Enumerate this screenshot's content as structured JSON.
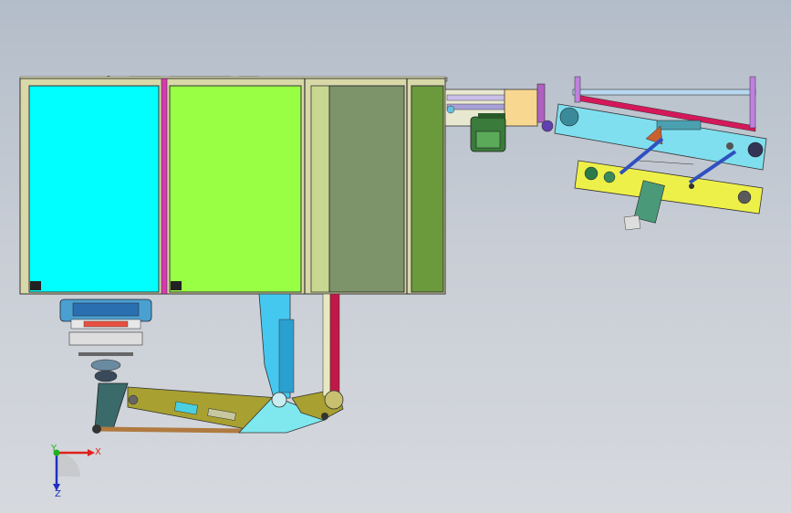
{
  "viewport": {
    "background_top": "#b3bdc9",
    "background_bottom": "#d6d9de"
  },
  "panels": {
    "cabinet_1_color": "#00ffff",
    "cabinet_2_color": "#99ff44",
    "cabinet_3_color": "#7d946a",
    "cabinet_4_color": "#6b9a3c",
    "conveyor_color": "#7fdfef",
    "lower_frame_color": "#eef04a",
    "accent_red": "#d4185a"
  },
  "triad": {
    "x_label": "X",
    "y_label": "Y",
    "z_label": "Z",
    "x_color": "#e0201a",
    "y_color": "#20b020",
    "z_color": "#2030c0"
  }
}
